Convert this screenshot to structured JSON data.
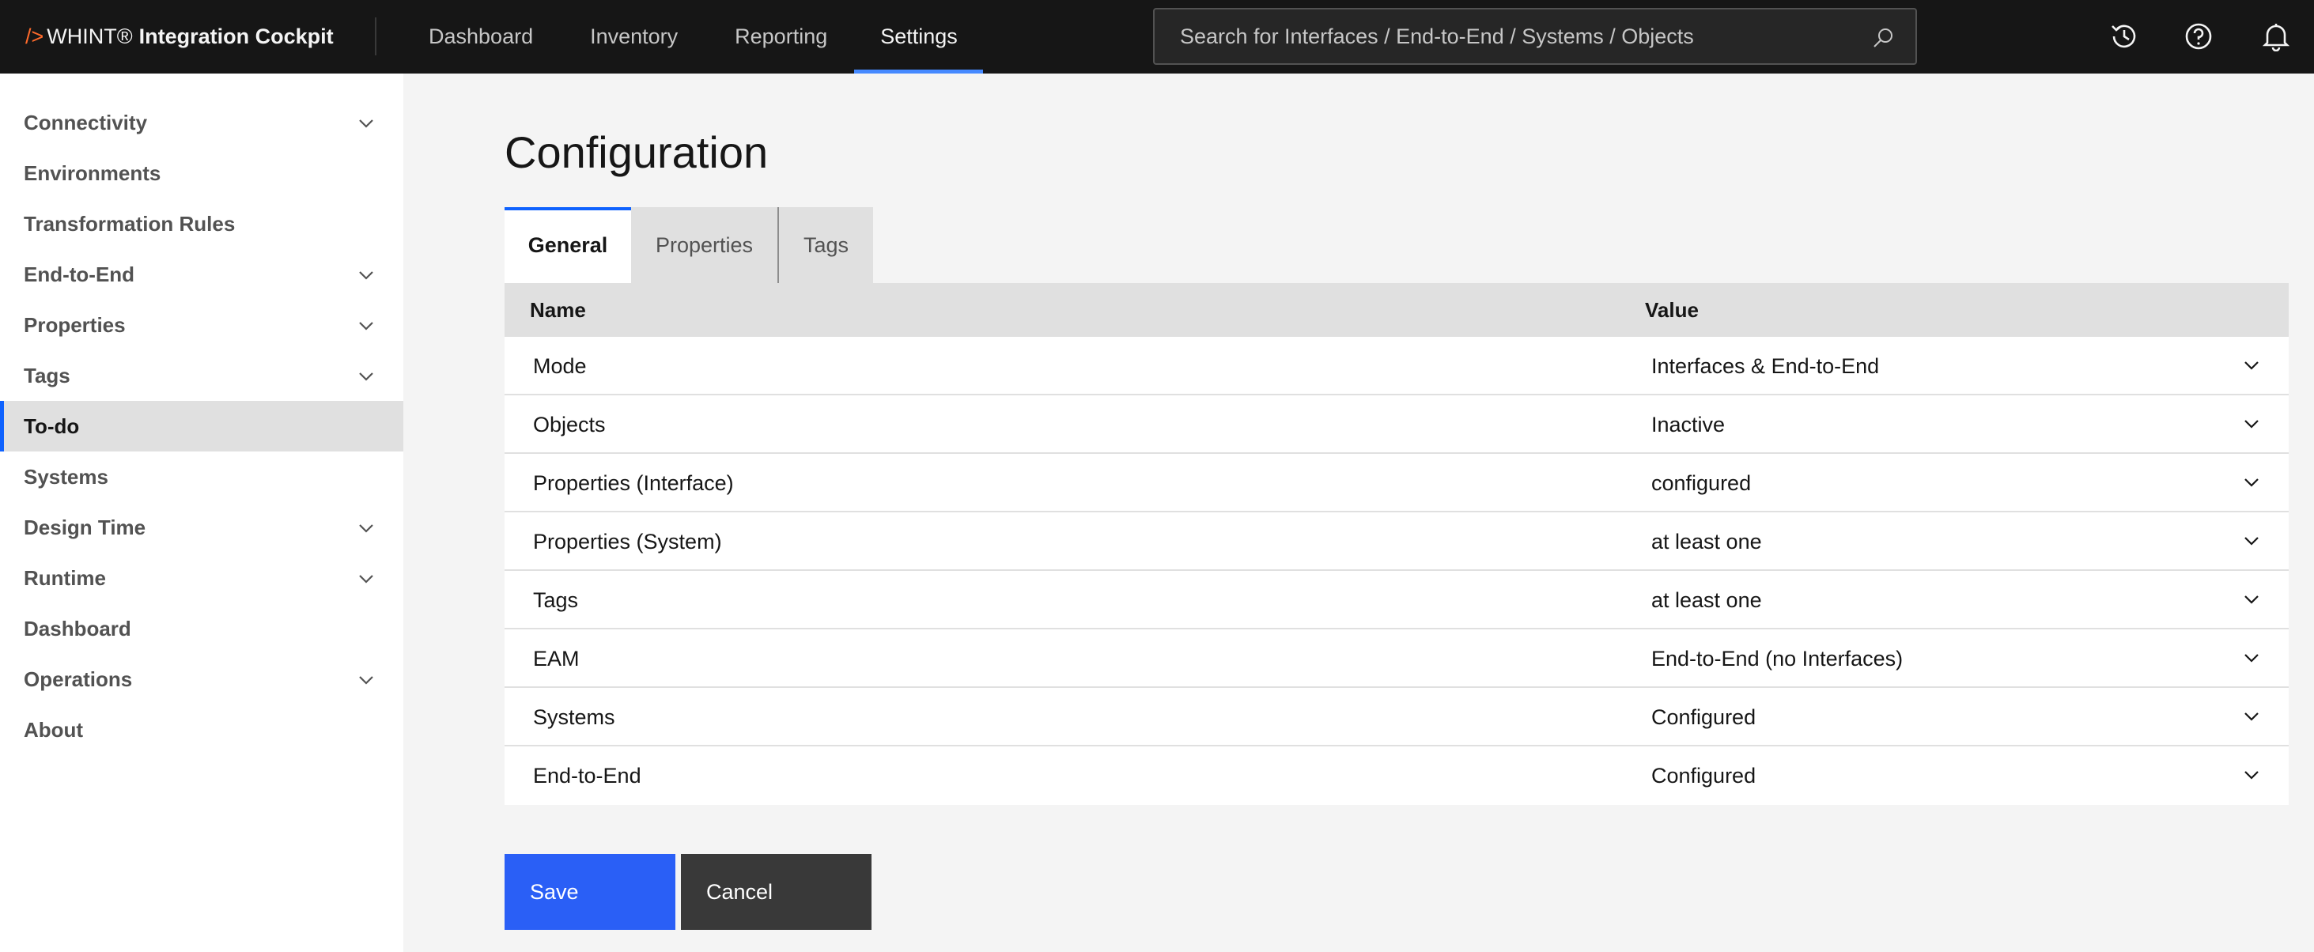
{
  "header": {
    "brand_mark": "/>",
    "brand_name1": "WHINT®",
    "brand_name2": "Integration Cockpit",
    "nav": [
      {
        "label": "Dashboard"
      },
      {
        "label": "Inventory"
      },
      {
        "label": "Reporting"
      },
      {
        "label": "Settings",
        "active": true
      }
    ],
    "search_placeholder": "Search for Interfaces / End-to-End / Systems / Objects",
    "icons": [
      "history-icon",
      "help-icon",
      "notification-bell-icon"
    ]
  },
  "sidebar": {
    "items": [
      {
        "label": "Connectivity",
        "expandable": true
      },
      {
        "label": "Environments",
        "expandable": false
      },
      {
        "label": "Transformation Rules",
        "expandable": false
      },
      {
        "label": "End-to-End",
        "expandable": true
      },
      {
        "label": "Properties",
        "expandable": true
      },
      {
        "label": "Tags",
        "expandable": true
      },
      {
        "label": "To-do",
        "expandable": false,
        "active": true
      },
      {
        "label": "Systems",
        "expandable": false
      },
      {
        "label": "Design Time",
        "expandable": true
      },
      {
        "label": "Runtime",
        "expandable": true
      },
      {
        "label": "Dashboard",
        "expandable": false
      },
      {
        "label": "Operations",
        "expandable": true
      },
      {
        "label": "About",
        "expandable": false
      }
    ]
  },
  "main": {
    "title": "Configuration",
    "tabs": [
      {
        "label": "General",
        "active": true
      },
      {
        "label": "Properties"
      },
      {
        "label": "Tags"
      }
    ],
    "table": {
      "headers": {
        "name": "Name",
        "value": "Value"
      },
      "rows": [
        {
          "name": "Mode",
          "value": "Interfaces & End-to-End"
        },
        {
          "name": "Objects",
          "value": "Inactive"
        },
        {
          "name": "Properties (Interface)",
          "value": "configured"
        },
        {
          "name": "Properties (System)",
          "value": "at least one"
        },
        {
          "name": "Tags",
          "value": "at least one"
        },
        {
          "name": "EAM",
          "value": "End-to-End (no Interfaces)"
        },
        {
          "name": "Systems",
          "value": "Configured"
        },
        {
          "name": "End-to-End",
          "value": "Configured"
        }
      ]
    },
    "buttons": {
      "save": "Save",
      "cancel": "Cancel"
    }
  },
  "colors": {
    "header_bg": "#161616",
    "accent": "#0f62fe",
    "nav_active_underline": "#4589ff",
    "brand_mark": "#ff6a2b",
    "cancel_bg": "#393939"
  }
}
